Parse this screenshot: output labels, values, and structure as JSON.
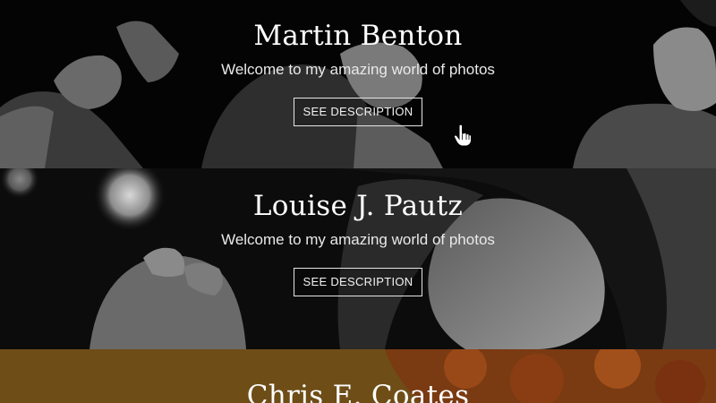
{
  "profiles": [
    {
      "name": "Martin Benton",
      "tagline": "Welcome to my amazing world of photos",
      "button_label": "SEE DESCRIPTION"
    },
    {
      "name": "Louise J. Pautz",
      "tagline": "Welcome to my amazing world of photos",
      "button_label": "SEE DESCRIPTION"
    },
    {
      "name": "Chris E. Coates"
    }
  ],
  "colors": {
    "section3_bg": "#6b4b16",
    "text": "#ffffff"
  },
  "icons": {
    "cursor": "hand-pointer-icon"
  }
}
